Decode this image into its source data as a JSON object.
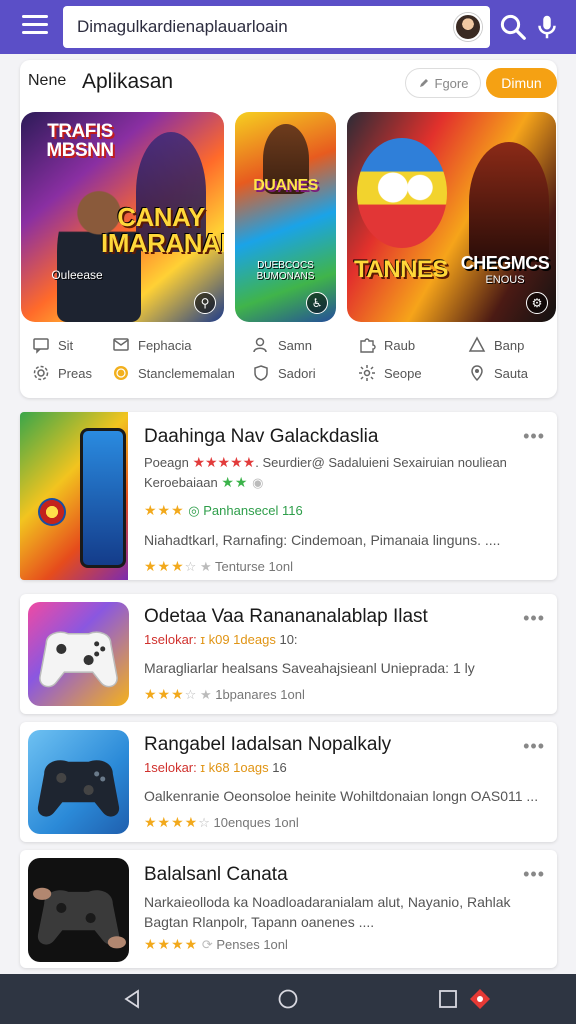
{
  "search": {
    "value": "Dimagulkardienaplauarloain"
  },
  "header": {
    "label": "Nene",
    "title": "Aplikasan",
    "outline_button": "Fgore",
    "primary_button": "Dimun"
  },
  "colors": {
    "appbar": "#5b4fc7",
    "accent": "#f5a113",
    "star": "#f2a91c",
    "navbar": "#2e3542"
  },
  "banners": [
    {
      "title": "CANAY IMARANAIS",
      "top_text": "TRAFIS MBSNN",
      "caption": "Ouleease"
    },
    {
      "title": "DUANES",
      "caption": "DUEBCOCS BUMONANS"
    },
    {
      "title": "TANNES",
      "title2": "CHEGMCS",
      "caption": "ENOUS"
    }
  ],
  "categories": [
    {
      "label": "Sit",
      "icon": "chat-icon"
    },
    {
      "label": "Fephacia",
      "icon": "message-icon"
    },
    {
      "label": "Samn",
      "icon": "user-icon"
    },
    {
      "label": "Raub",
      "icon": "puzzle-icon"
    },
    {
      "label": "Banp",
      "icon": "triangle-icon"
    },
    {
      "label": "Preas",
      "icon": "gear-icon"
    },
    {
      "label": "Stanclememalan",
      "icon": "coin-icon"
    },
    {
      "label": "Sadori",
      "icon": "shield-icon"
    },
    {
      "label": "Seope",
      "icon": "cog-icon"
    },
    {
      "label": "Sauta",
      "icon": "pin-icon"
    }
  ],
  "apps": [
    {
      "title": "Daahinga Nav Galackdaslia",
      "line1_prefix": "Poeagn",
      "line1_stars": "★★★★★",
      "line1_suffix": ". Seurdier@ Sadaluieni Sexairuian nouliean",
      "line2_text": "Keroebaiaan",
      "line2_stars": "★★",
      "rating_stars": "★★★",
      "rating_text": "Panhansecel 116",
      "desc": "Niahadtkarl, Rarnafing: Cindemoan, Pimanaia linguns. ....",
      "bottom_stars": "★★★",
      "bottom_empty": "☆",
      "bottom_text": "Tenturse 1onl"
    },
    {
      "title": "Odetaa Vaa Ranananalablap Ilast",
      "meta_a": "1selokar:",
      "meta_b": "ɪ k09 1deags",
      "meta_c": "10:",
      "desc": "Maragliarlar healsans Saveahajsieanl Unieprada: 1 ly",
      "stars": "★★★",
      "empty": "☆",
      "count": "1bpanares 1onl"
    },
    {
      "title": "Rangabel Iadalsan Nopalkaly",
      "meta_a": "1selokar:",
      "meta_b": "ɪ k68 1oags",
      "meta_c": "16",
      "desc": "Oalkenranie Oeonsoloe heinite Wohiltdonaian longn OAS011 ...",
      "stars": "★★★★",
      "empty": "☆",
      "count": "10enques 1onl"
    },
    {
      "title": "Balalsanl Canata",
      "desc": "Narkaieolloda ka Noadloadaranialam alut, Nayanio, Rahlak Bagtan Rlanpolr, Tapann oanenes ....",
      "stars": "★★★★",
      "count": "Penses 1onl"
    }
  ]
}
